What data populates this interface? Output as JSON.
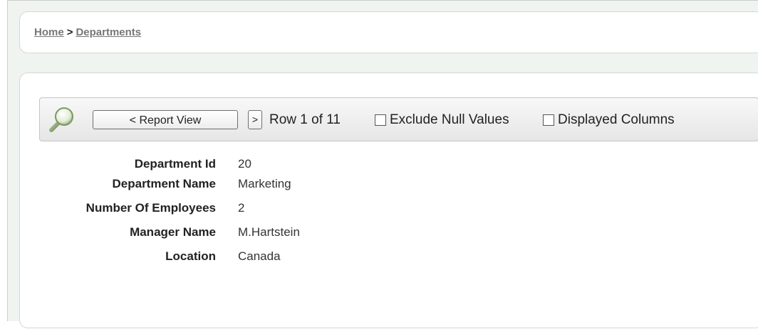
{
  "breadcrumb": {
    "home": "Home",
    "separator": ">",
    "current": "Departments"
  },
  "toolbar": {
    "search_icon": "magnifier-icon",
    "report_view_label": "< Report View",
    "next_label": ">",
    "row_info": "Row 1 of 11",
    "exclude_null_label": "Exclude Null Values",
    "exclude_null_checked": false,
    "displayed_columns_label": "Displayed Columns",
    "displayed_columns_checked": false
  },
  "record": {
    "fields": [
      {
        "label": "Department Id",
        "value": "20"
      },
      {
        "label": "Department Name",
        "value": "Marketing"
      },
      {
        "label": "Number Of Employees",
        "value": "2"
      },
      {
        "label": "Manager Name",
        "value": "M.Hartstein"
      },
      {
        "label": "Location",
        "value": "Canada"
      }
    ]
  },
  "colors": {
    "page_background": "#f0f4f1",
    "panel_background": "#ffffff",
    "link": "#777777"
  }
}
